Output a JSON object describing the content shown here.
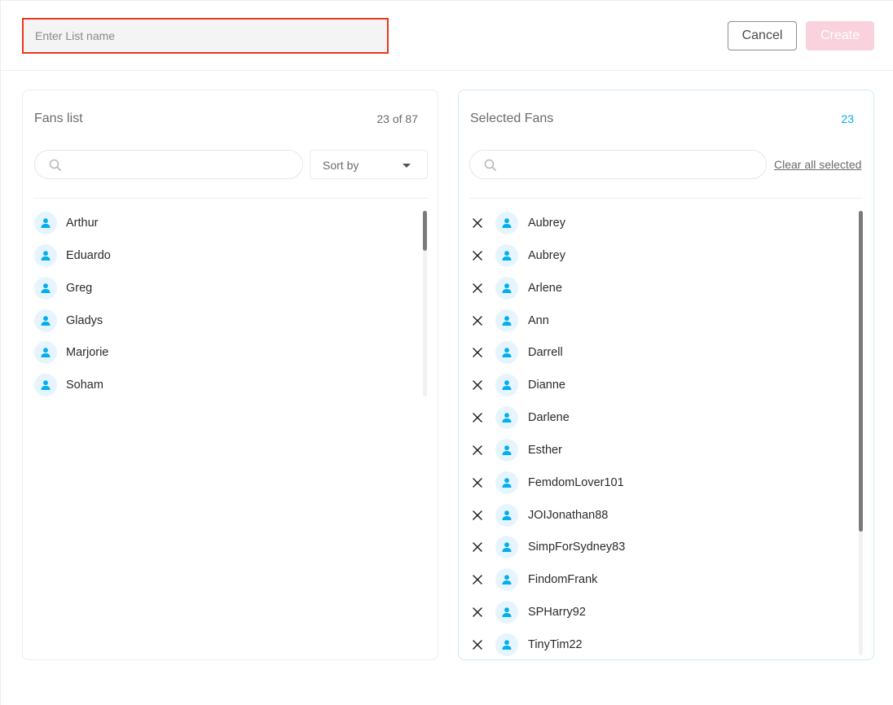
{
  "header": {
    "list_name_placeholder": "Enter List name",
    "cancel_label": "Cancel",
    "create_label": "Create"
  },
  "fans_list": {
    "title": "Fans list",
    "count": "23 of 87",
    "sort_label": "Sort by",
    "items": [
      {
        "name": "Arthur",
        "icon": "user-icon"
      },
      {
        "name": "Eduardo",
        "icon": "user-icon"
      },
      {
        "name": "Greg",
        "icon": "user-icon"
      },
      {
        "name": "Gladys",
        "icon": "user-icon"
      },
      {
        "name": "Marjorie",
        "icon": "user-icon"
      },
      {
        "name": "Soham",
        "icon": "user-icon"
      }
    ]
  },
  "selected_fans": {
    "title": "Selected Fans",
    "count": "23",
    "clear_label": "Clear all selected",
    "items": [
      {
        "name": "Aubrey"
      },
      {
        "name": "Aubrey"
      },
      {
        "name": "Arlene"
      },
      {
        "name": "Ann"
      },
      {
        "name": "Darrell"
      },
      {
        "name": "Dianne"
      },
      {
        "name": "Darlene"
      },
      {
        "name": "Esther"
      },
      {
        "name": "FemdomLover101"
      },
      {
        "name": "JOIJonathan88"
      },
      {
        "name": "SimpForSydney83"
      },
      {
        "name": "FindomFrank"
      },
      {
        "name": "SPHarry92"
      },
      {
        "name": "TinyTim22"
      }
    ]
  },
  "colors": {
    "accent": "#00aff0",
    "highlight_border": "#e8391c",
    "create_disabled": "#f9d2de"
  }
}
